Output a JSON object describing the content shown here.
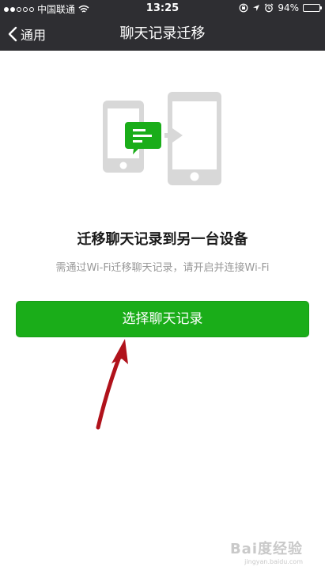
{
  "status_bar": {
    "carrier": "中国联通",
    "time": "13:25",
    "battery_percent": "94%",
    "battery_level": 0.94
  },
  "nav": {
    "back_label": "通用",
    "title": "聊天记录迁移"
  },
  "main": {
    "heading": "迁移聊天记录到另一台设备",
    "description": "需通过Wi-Fi迁移聊天记录，请开启并连接Wi-Fi",
    "button_label": "选择聊天记录"
  },
  "watermark": {
    "brand": "Bai度经验",
    "url": "jingyan.baidu.com"
  },
  "colors": {
    "nav_bg": "#2e2e32",
    "accent_green": "#1aad19",
    "illustration_gray": "#d8d8d8",
    "annotation_red": "#b0121b"
  }
}
